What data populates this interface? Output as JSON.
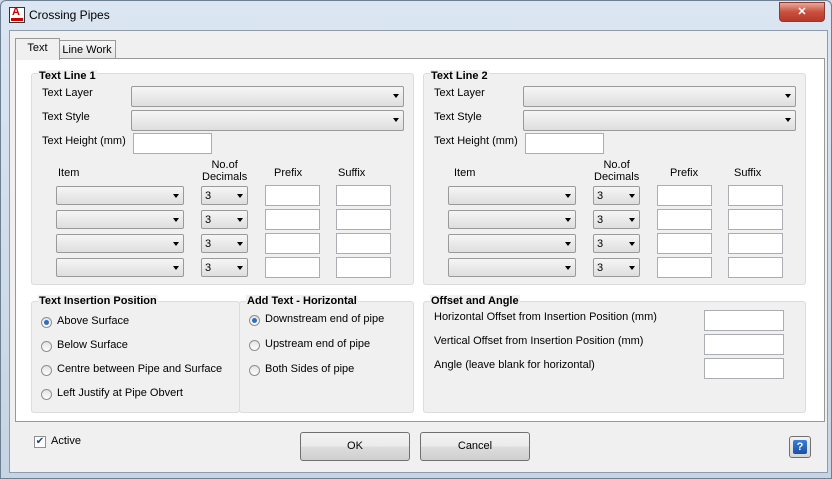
{
  "window": {
    "title": "Crossing Pipes",
    "close_glyph": "✕"
  },
  "tabs": [
    {
      "label": "Text"
    },
    {
      "label": "Line Work"
    }
  ],
  "text_line_1": {
    "title": "Text Line 1",
    "text_layer_label": "Text Layer",
    "text_style_label": "Text Style",
    "text_height_label": "Text Height (mm)",
    "col_item": "Item",
    "col_decimals": "No.of\nDecimals",
    "col_prefix": "Prefix",
    "col_suffix": "Suffix",
    "decimals": [
      "3",
      "3",
      "3",
      "3"
    ]
  },
  "text_line_2": {
    "title": "Text Line 2",
    "text_layer_label": "Text Layer",
    "text_style_label": "Text Style",
    "text_height_label": "Text Height (mm)",
    "col_item": "Item",
    "col_decimals": "No.of\nDecimals",
    "col_prefix": "Prefix",
    "col_suffix": "Suffix",
    "decimals": [
      "3",
      "3",
      "3",
      "3"
    ]
  },
  "insertion_position": {
    "title": "Text Insertion Position",
    "options": [
      "Above Surface",
      "Below Surface",
      "Centre between Pipe and Surface",
      "Left Justify at Pipe Obvert"
    ],
    "selected": 0
  },
  "add_text_horizontal": {
    "title": "Add Text - Horizontal",
    "options": [
      "Downstream end of pipe",
      "Upstream end of pipe",
      "Both Sides of pipe"
    ],
    "selected": 0
  },
  "offset_angle": {
    "title": "Offset and Angle",
    "horizontal_label": "Horizontal Offset from Insertion Position (mm)",
    "vertical_label": "Vertical Offset from Insertion Position (mm)",
    "angle_label": "Angle (leave blank for horizontal)"
  },
  "footer": {
    "active_label": "Active",
    "active_checked": true,
    "ok_label": "OK",
    "cancel_label": "Cancel",
    "help_glyph": "?"
  }
}
